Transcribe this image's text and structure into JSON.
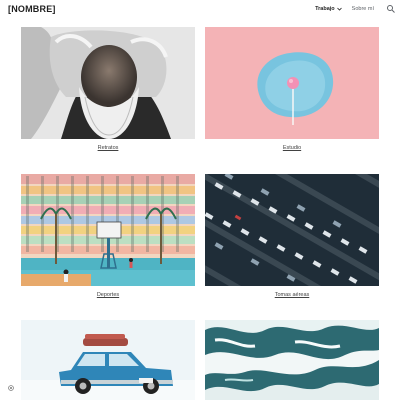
{
  "header": {
    "site_title": "[NOMBRE]",
    "nav": {
      "trabajo_label": "Trabajo",
      "sobre_label": "Sobre mí"
    }
  },
  "gallery": {
    "items": [
      {
        "caption": "Retratos",
        "image": "portrait-old-man-white-beard"
      },
      {
        "caption": "Estudio",
        "image": "lollipop-on-blue-plate-pink-background"
      },
      {
        "caption": "Deportes",
        "image": "basketball-court-colorful-apartments"
      },
      {
        "caption": "Tomas aéreas",
        "image": "aerial-parking-lot-cars"
      },
      {
        "caption": "",
        "image": "blue-vintage-car-with-luggage-snow"
      },
      {
        "caption": "",
        "image": "ocean-waves-foam"
      }
    ]
  },
  "footer": {
    "settings_icon": "gear-icon"
  }
}
